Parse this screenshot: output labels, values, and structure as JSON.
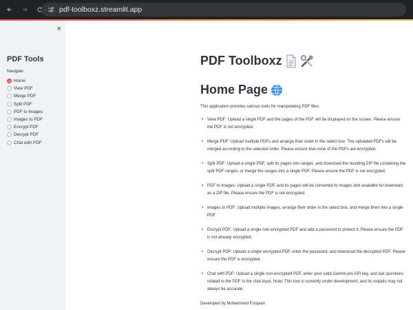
{
  "browser": {
    "url": "pdf-toolboxz.streamlit.app",
    "back_icon": "back-arrow-icon",
    "forward_icon": "forward-arrow-icon",
    "reload_icon": "reload-icon",
    "site_info_icon": "site-settings-icon"
  },
  "sidebar": {
    "close_label": "×",
    "title": "PDF Tools",
    "nav_label": "Navigate",
    "options": [
      "Home",
      "View PDF",
      "Merge PDF",
      "Split PDF",
      "PDF to Images",
      "Images to PDF",
      "Encrypt PDF",
      "Decrypt PDF",
      "Chat with PDF"
    ],
    "selected": "Home"
  },
  "main": {
    "title": "PDF Toolboxz",
    "title_emojis": [
      "page-icon",
      "tools-icon"
    ],
    "subtitle": "Home Page",
    "subtitle_emoji": "globe-icon",
    "intro": "This application provides various tools for manipulating PDF files:",
    "items": [
      "View PDF: Upload a single PDF and the pages of the PDF will be displayed on the screen. Please ensure the PDF is not encrypted.",
      "Merge PDF: Upload multiple PDFs and arrange their order in the select box. The uploaded PDFs will be merged according to the selected order. Please ensure that none of the PDFs are encrypted.",
      "Split PDF: Upload a single PDF, split its pages into ranges, and download the resulting ZIP file containing the split PDF ranges, or merge the ranges into a single PDF. Please ensure the PDF is not encrypted.",
      "PDF to Images: Upload a single PDF, and its pages will be converted to images and available for download as a ZIP file. Please ensure the PDF is not encrypted.",
      "Images to PDF: Upload multiple images, arrange their order in the select box, and merge them into a single PDF.",
      "Encrypt PDF: Upload a single non-encrypted PDF and add a password to protect it. Please ensure the PDF is not already encrypted.",
      "Decrypt PDF: Upload a single encrypted PDF, enter the password, and download the decrypted PDF. Please ensure the PDF is encrypted.",
      "Chat with PDF: Upload a single non-encrypted PDF, enter your valid Gemini-pro API key, and ask questions related to the PDF in the chat input. Note: This tool is currently under development, and its outputs may not always be accurate."
    ],
    "footer": "Developed by Mohammed Furqaan"
  },
  "colors": {
    "accent": "#ff4b4b",
    "sidebar_bg": "#f0f2f6",
    "text": "#31333f",
    "chrome_bg": "#202124"
  }
}
